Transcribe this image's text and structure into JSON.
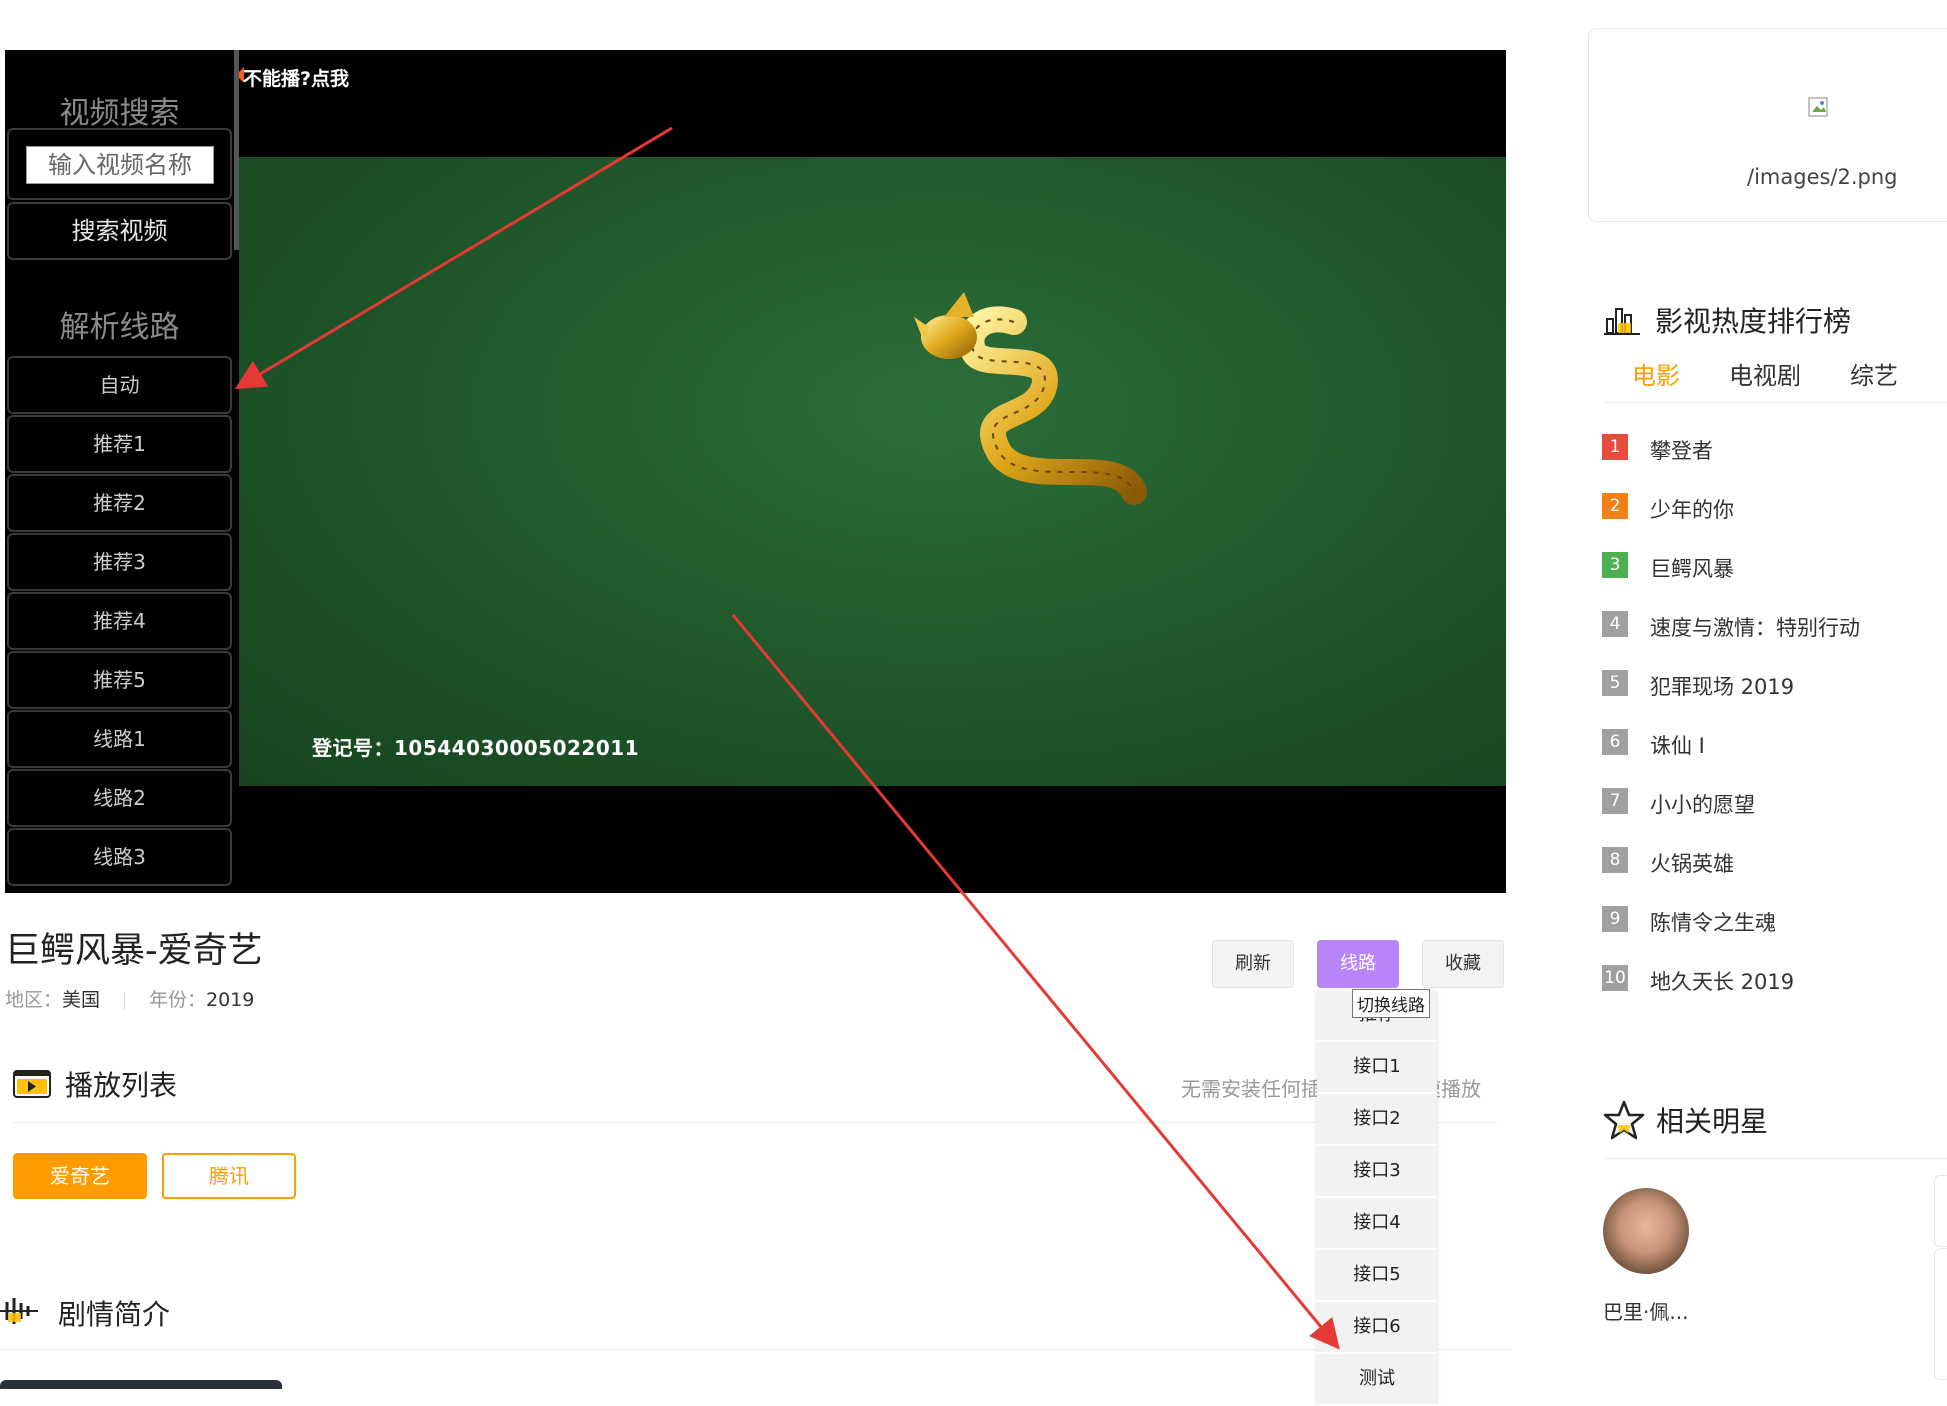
{
  "player": {
    "cant_play_label": "不能播?点我",
    "registration_text": "登记号：10544030005022011",
    "sidebar": {
      "search_title": "视频搜索",
      "search_placeholder": "输入视频名称",
      "search_button": "搜索视频",
      "routes_title": "解析线路",
      "routes": [
        "自动",
        "推荐1",
        "推荐2",
        "推荐3",
        "推荐4",
        "推荐5",
        "线路1",
        "线路2",
        "线路3"
      ]
    }
  },
  "movie": {
    "title": "巨鳄风暴-爱奇艺",
    "region_label": "地区：",
    "region": "美国",
    "year_label": "年份：",
    "year": "2019"
  },
  "actions": {
    "refresh": "刷新",
    "route": "线路",
    "favorite": "收藏",
    "route_tooltip": "切换线路",
    "route_menu": [
      "推荐",
      "接口1",
      "接口2",
      "接口3",
      "接口4",
      "接口5",
      "接口6",
      "测试"
    ]
  },
  "playlist": {
    "title": "播放列表",
    "tip": "无需安装任何插件，即可快速播放",
    "sources": [
      "爱奇艺",
      "腾讯"
    ]
  },
  "plot": {
    "title": "剧情简介"
  },
  "ad": {
    "alt_text": "/images/2.png"
  },
  "ranking": {
    "title": "影视热度排行榜",
    "tabs": [
      "电影",
      "电视剧",
      "综艺"
    ],
    "items": [
      {
        "rank": "1",
        "name": "攀登者",
        "color": "#e84c3d"
      },
      {
        "rank": "2",
        "name": "少年的你",
        "color": "#f57f17"
      },
      {
        "rank": "3",
        "name": "巨鳄风暴",
        "color": "#4caf50"
      },
      {
        "rank": "4",
        "name": "速度与激情：特别行动",
        "color": "#a0a0a0"
      },
      {
        "rank": "5",
        "name": "犯罪现场 2019",
        "color": "#a0a0a0"
      },
      {
        "rank": "6",
        "name": "诛仙 Ⅰ",
        "color": "#a0a0a0"
      },
      {
        "rank": "7",
        "name": "小小的愿望",
        "color": "#a0a0a0"
      },
      {
        "rank": "8",
        "name": "火锅英雄",
        "color": "#a0a0a0"
      },
      {
        "rank": "9",
        "name": "陈情令之生魂",
        "color": "#a0a0a0"
      },
      {
        "rank": "10",
        "name": "地久天长 2019",
        "color": "#a0a0a0"
      }
    ]
  },
  "stars": {
    "title": "相关明星",
    "people": [
      {
        "name": "巴里·佩..."
      }
    ]
  },
  "colors": {
    "accent": "#ff9c00",
    "route_button": "#b785f7",
    "annotation_arrow": "#e53935"
  }
}
